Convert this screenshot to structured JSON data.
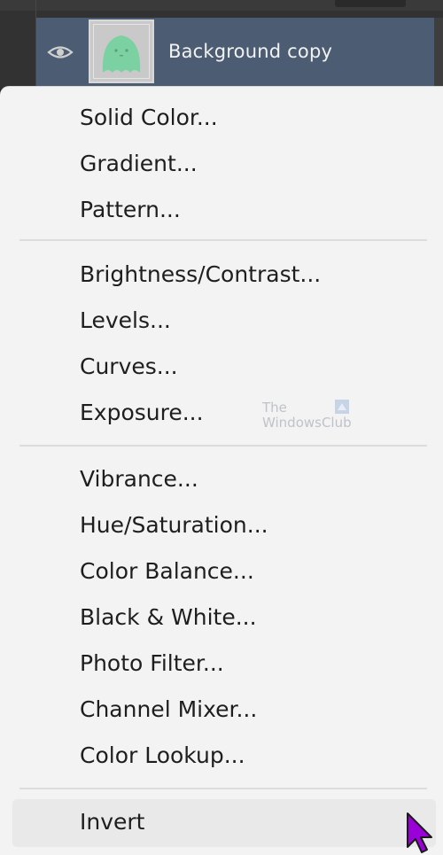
{
  "layers": {
    "active_layer_name": "Background copy"
  },
  "menu": {
    "group1": [
      "Solid Color...",
      "Gradient...",
      "Pattern..."
    ],
    "group2": [
      "Brightness/Contrast...",
      "Levels...",
      "Curves...",
      "Exposure..."
    ],
    "group3": [
      "Vibrance...",
      "Hue/Saturation...",
      "Color Balance...",
      "Black & White...",
      "Photo Filter...",
      "Channel Mixer...",
      "Color Lookup..."
    ],
    "group4": [
      "Invert"
    ]
  },
  "watermark": {
    "line1": "The",
    "line2": "WindowsClub"
  },
  "colors": {
    "selected_layer": "#4c5d73",
    "menu_background": "#f3f3f3",
    "cursor": "#9a00d8"
  }
}
